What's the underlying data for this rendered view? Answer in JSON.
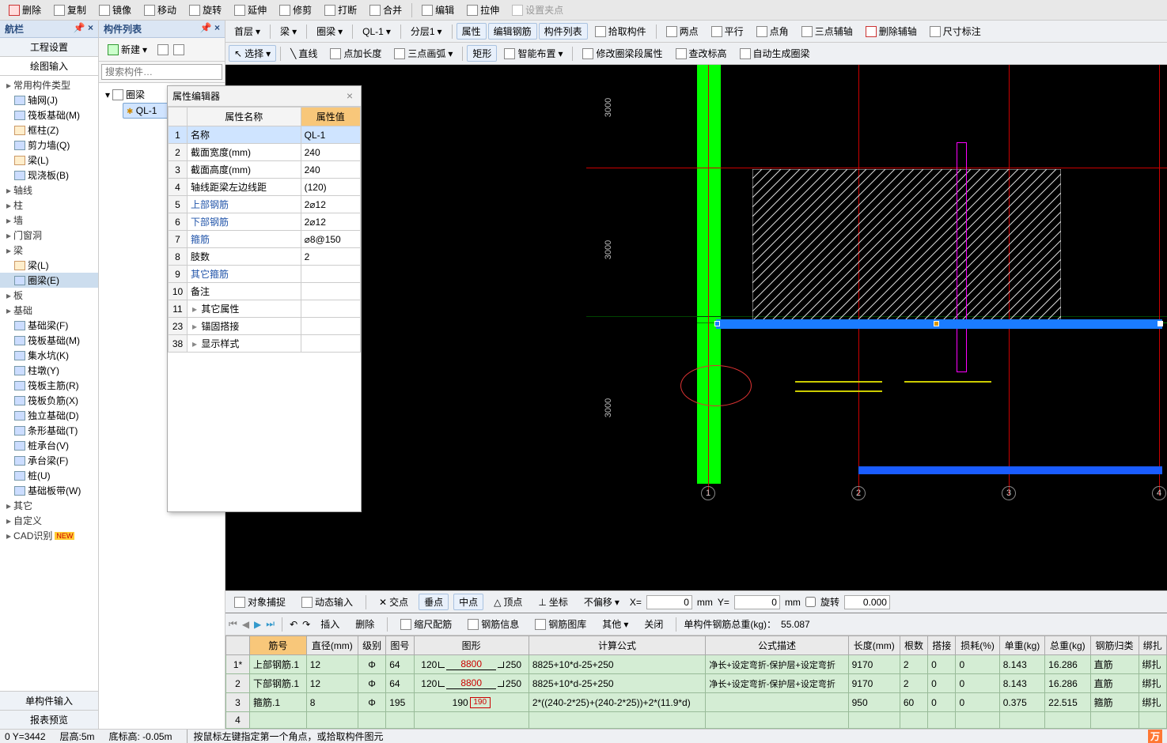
{
  "toolbar_top": {
    "items": [
      "删除",
      "复制",
      "镜像",
      "移动",
      "旋转",
      "延伸",
      "修剪",
      "打断",
      "合并",
      "编辑",
      "拉伸",
      "设置夹点"
    ]
  },
  "toolbar2": {
    "floor": "首层",
    "type": "梁",
    "sub": "圈梁",
    "comp": "QL-1",
    "layer": "分层1",
    "items": [
      "属性",
      "编辑钢筋",
      "构件列表",
      "拾取构件",
      "两点",
      "平行",
      "点角",
      "三点辅轴",
      "删除辅轴",
      "尺寸标注"
    ]
  },
  "toolbar3": {
    "select": "选择",
    "items": [
      "直线",
      "点加长度",
      "三点画弧",
      "矩形",
      "智能布置",
      "修改圈梁段属性",
      "查改标高",
      "自动生成圈梁"
    ]
  },
  "nav": {
    "title": "航栏",
    "btns": [
      "工程设置",
      "绘图输入"
    ],
    "btm": [
      "单构件输入",
      "报表预览"
    ],
    "items": [
      {
        "hdr": "常用构件类型"
      },
      {
        "label": "轴网(J)",
        "ico": "blue"
      },
      {
        "label": "筏板基础(M)",
        "ico": "blue"
      },
      {
        "label": "框柱(Z)",
        "ico": "orange"
      },
      {
        "label": "剪力墙(Q)",
        "ico": "blue"
      },
      {
        "label": "梁(L)",
        "ico": "orange"
      },
      {
        "label": "现浇板(B)",
        "ico": "blue"
      },
      {
        "hdr": "轴线"
      },
      {
        "hdr": "柱"
      },
      {
        "hdr": "墙"
      },
      {
        "hdr": "门窗洞"
      },
      {
        "hdr": "梁"
      },
      {
        "label": "梁(L)",
        "ico": "orange"
      },
      {
        "label": "圈梁(E)",
        "ico": "blue",
        "sel": true
      },
      {
        "hdr": "板"
      },
      {
        "hdr": "基础"
      },
      {
        "label": "基础梁(F)",
        "ico": "blue"
      },
      {
        "label": "筏板基础(M)",
        "ico": "blue"
      },
      {
        "label": "集水坑(K)",
        "ico": "blue"
      },
      {
        "label": "柱墩(Y)",
        "ico": "blue"
      },
      {
        "label": "筏板主筋(R)",
        "ico": "blue"
      },
      {
        "label": "筏板负筋(X)",
        "ico": "blue"
      },
      {
        "label": "独立基础(D)",
        "ico": "blue"
      },
      {
        "label": "条形基础(T)",
        "ico": "blue"
      },
      {
        "label": "桩承台(V)",
        "ico": "blue"
      },
      {
        "label": "承台梁(F)",
        "ico": "blue"
      },
      {
        "label": "桩(U)",
        "ico": "blue"
      },
      {
        "label": "基础板带(W)",
        "ico": "blue"
      },
      {
        "hdr": "其它"
      },
      {
        "hdr": "自定义"
      },
      {
        "hdr": "CAD识别",
        "new": true
      }
    ]
  },
  "complist": {
    "title": "构件列表",
    "newbtn": "新建",
    "search_ph": "搜索构件…",
    "group": "圈梁",
    "leaf": "QL-1"
  },
  "propedit": {
    "title": "属性编辑器",
    "cols": [
      "属性名称",
      "属性值"
    ],
    "rows": [
      {
        "n": "1",
        "name": "名称",
        "val": "QL-1",
        "hl": true
      },
      {
        "n": "2",
        "name": "截面宽度(mm)",
        "val": "240"
      },
      {
        "n": "3",
        "name": "截面高度(mm)",
        "val": "240"
      },
      {
        "n": "4",
        "name": "轴线距梁左边线距",
        "val": "(120)"
      },
      {
        "n": "5",
        "name": "上部钢筋",
        "val": "2⌀12",
        "link": true
      },
      {
        "n": "6",
        "name": "下部钢筋",
        "val": "2⌀12",
        "link": true
      },
      {
        "n": "7",
        "name": "箍筋",
        "val": "⌀8@150",
        "link": true
      },
      {
        "n": "8",
        "name": "肢数",
        "val": "2"
      },
      {
        "n": "9",
        "name": "其它箍筋",
        "val": "",
        "link": true
      },
      {
        "n": "10",
        "name": "备注",
        "val": ""
      },
      {
        "n": "11",
        "name": "其它属性",
        "val": "",
        "expand": true
      },
      {
        "n": "23",
        "name": "锚固搭接",
        "val": "",
        "expand": true
      },
      {
        "n": "38",
        "name": "显示样式",
        "val": "",
        "expand": true
      }
    ]
  },
  "snapbar": {
    "items": [
      "对象捕捉",
      "动态输入",
      "交点",
      "垂点",
      "中点",
      "顶点",
      "坐标"
    ],
    "offset": "不偏移",
    "x_lbl": "X=",
    "x_val": "0",
    "x_unit": "mm",
    "y_lbl": "Y=",
    "y_val": "0",
    "y_unit": "mm",
    "rotate": "旋转",
    "rotate_val": "0.000"
  },
  "databar": {
    "items": [
      "插入",
      "删除",
      "缩尺配筋",
      "钢筋信息",
      "钢筋图库",
      "其他",
      "关闭"
    ],
    "total_lbl": "单构件钢筋总重(kg)：",
    "total_val": "55.087"
  },
  "grid": {
    "headers": [
      "",
      "筋号",
      "直径(mm)",
      "级别",
      "图号",
      "图形",
      "计算公式",
      "公式描述",
      "长度(mm)",
      "根数",
      "搭接",
      "损耗(%)",
      "单重(kg)",
      "总重(kg)",
      "钢筋归类",
      "绑扎"
    ],
    "rows": [
      {
        "n": "1*",
        "name": "上部钢筋.1",
        "d": "12",
        "lv": "Φ",
        "img": "64",
        "s1": "120",
        "s2": "8800",
        "s3": "250",
        "formula": "8825+10*d-25+250",
        "desc": "净长+设定弯折-保护层+设定弯折",
        "len": "9170",
        "cnt": "2",
        "lap": "0",
        "loss": "0",
        "uw": "8.143",
        "tw": "16.286",
        "cls": "直筋",
        "bind": "绑扎"
      },
      {
        "n": "2",
        "name": "下部钢筋.1",
        "d": "12",
        "lv": "Φ",
        "img": "64",
        "s1": "120",
        "s2": "8800",
        "s3": "250",
        "formula": "8825+10*d-25+250",
        "desc": "净长+设定弯折-保护层+设定弯折",
        "len": "9170",
        "cnt": "2",
        "lap": "0",
        "loss": "0",
        "uw": "8.143",
        "tw": "16.286",
        "cls": "直筋",
        "bind": "绑扎"
      },
      {
        "n": "3",
        "name": "箍筋.1",
        "d": "8",
        "lv": "Φ",
        "img": "195",
        "s1": "190",
        "s2": "190",
        "s3": "",
        "formula": "2*((240-2*25)+(240-2*25))+2*(11.9*d)",
        "desc": "",
        "len": "950",
        "cnt": "60",
        "lap": "0",
        "loss": "0",
        "uw": "0.375",
        "tw": "22.515",
        "cls": "箍筋",
        "bind": "绑扎"
      },
      {
        "n": "4",
        "name": "",
        "d": "",
        "lv": "",
        "img": "",
        "s1": "",
        "s2": "",
        "s3": "",
        "formula": "",
        "desc": "",
        "len": "",
        "cnt": "",
        "lap": "",
        "loss": "",
        "uw": "",
        "tw": "",
        "cls": "",
        "bind": ""
      }
    ]
  },
  "status": {
    "coord": "0  Y=3442",
    "floor_h": "层高:5m",
    "btm": "底标高: -0.05m",
    "info": "按鼠标左键指定第一个角点，或拾取构件图元"
  },
  "axis_dims": [
    "3000",
    "3000",
    "3000"
  ],
  "axis_nums": [
    "1",
    "2",
    "3",
    "4"
  ]
}
